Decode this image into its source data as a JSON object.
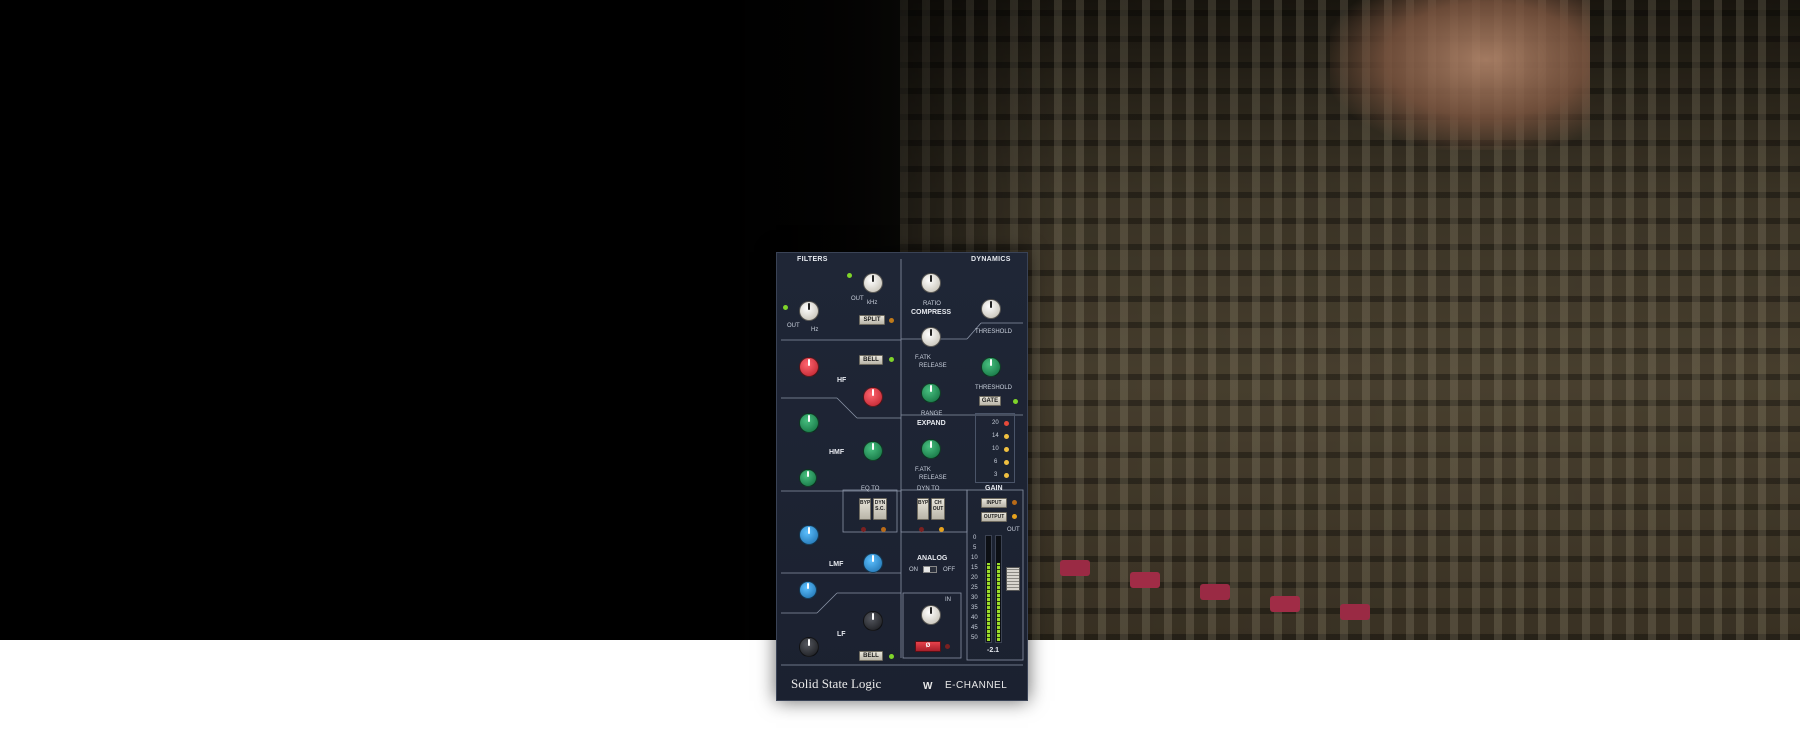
{
  "plugin": {
    "brand": "Solid State Logic",
    "model": "E-CHANNEL",
    "logo_glyph": "W",
    "sections": {
      "filters": "FILTERS",
      "dynamics": "DYNAMICS",
      "eq_to": "EQ TO",
      "dyn_to": "DYN TO",
      "gain": "GAIN",
      "analog": "ANALOG"
    },
    "labels": {
      "hf": "HF",
      "hmf": "HMF",
      "lmf": "LMF",
      "lf": "LF",
      "compress": "COMPRESS",
      "expand": "EXPAND",
      "ratio": "RATIO",
      "threshold": "THRESHOLD",
      "release": "RELEASE",
      "range": "RANGE",
      "fatk": "F.ATK",
      "out": "OUT",
      "khz": "kHz",
      "hz": "Hz",
      "db": "dB",
      "on": "ON",
      "off": "OFF",
      "in": "IN",
      "meter_out": "OUT",
      "meter_value": "-2.1"
    },
    "buttons": {
      "split": "SPLIT",
      "bell_hf": "BELL",
      "bell_lf": "BELL",
      "gate": "GATE",
      "eq_byp": "BYP",
      "eq_dyn_sc": "DYN S.C.",
      "dyn_byp": "BYP",
      "dyn_ch_out": "CH OUT",
      "input": "INPUT",
      "output": "OUTPUT",
      "phase": "Ø"
    },
    "gr_meter": [
      "20",
      "14",
      "10",
      "6",
      "3"
    ],
    "out_meter_scale": [
      "0",
      "5",
      "10",
      "15",
      "20",
      "25",
      "30",
      "35",
      "40",
      "45",
      "50"
    ],
    "knob_colors": {
      "white": "#e8e4da",
      "red": "#d8313a",
      "green": "#1f8a55",
      "blue": "#2a8fd0",
      "black": "#2b2d33"
    }
  }
}
